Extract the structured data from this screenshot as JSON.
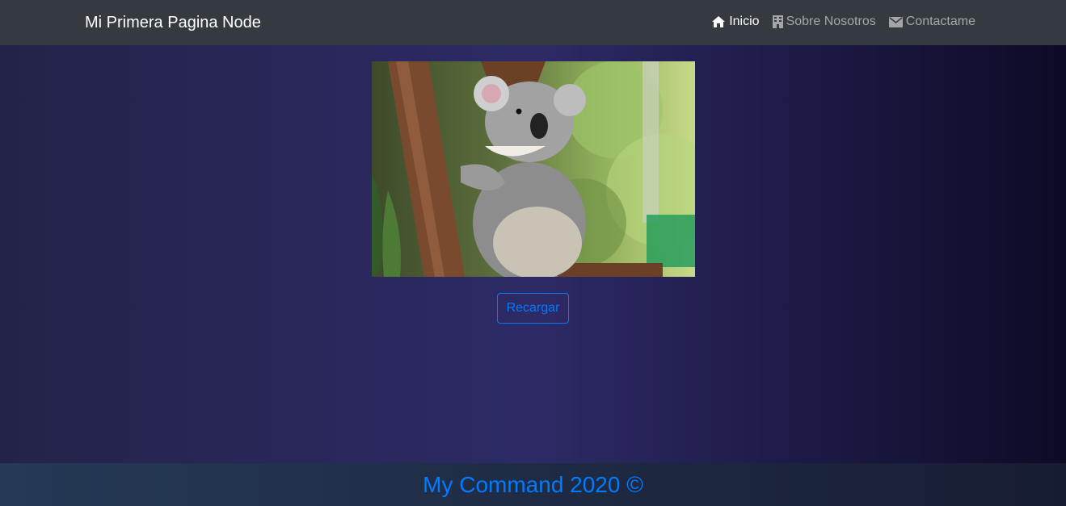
{
  "colors": {
    "navbar_bg": "#343a40",
    "accent": "#007bff",
    "nav_inactive": "rgba(255,255,255,0.55)",
    "nav_active": "#ffffff"
  },
  "navbar": {
    "brand": "Mi Primera Pagina Node",
    "links": [
      {
        "label": "Inicio",
        "icon": "home-icon",
        "active": true
      },
      {
        "label": "Sobre Nosotros",
        "icon": "building-icon",
        "active": false
      },
      {
        "label": "Contactame",
        "icon": "envelope-icon",
        "active": false
      }
    ]
  },
  "main": {
    "image_alt": "koala",
    "reload_button": "Recargar"
  },
  "footer": {
    "text": "My Command 2020 ©"
  }
}
